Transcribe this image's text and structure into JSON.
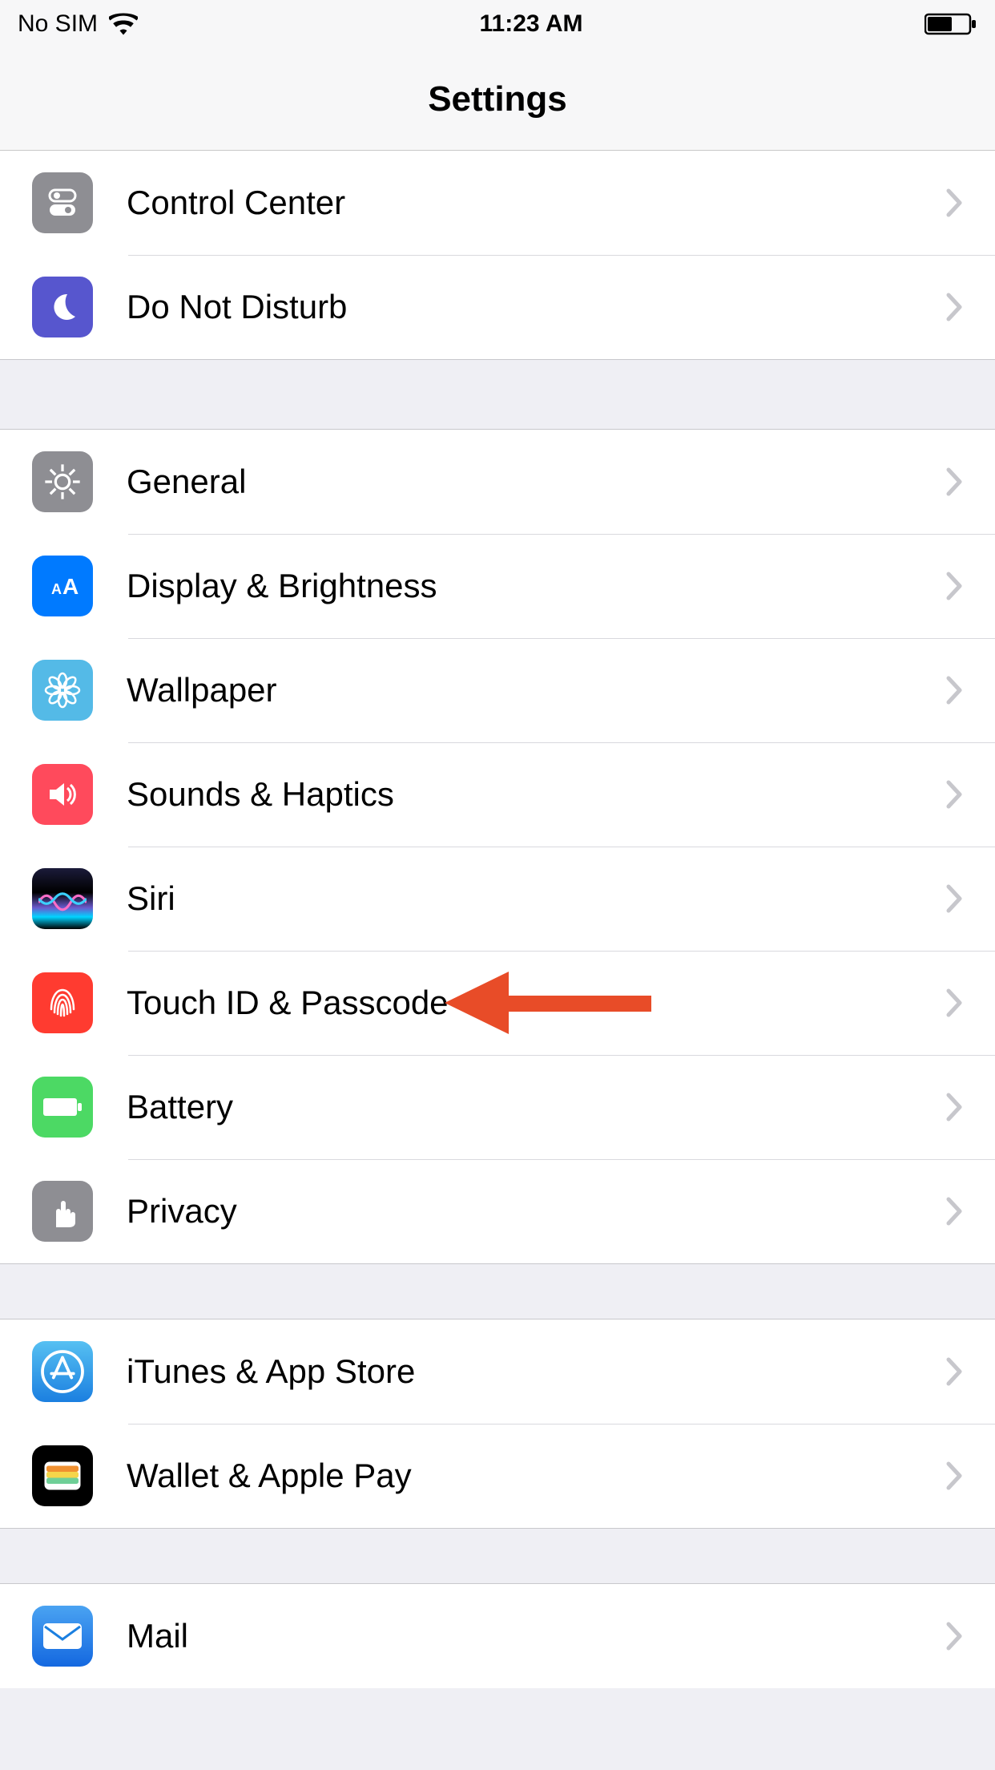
{
  "status_bar": {
    "carrier": "No SIM",
    "time": "11:23 AM"
  },
  "header": {
    "title": "Settings"
  },
  "groups": [
    {
      "items": [
        {
          "id": "control-center",
          "label": "Control Center",
          "icon": "toggles-icon",
          "bg": "bg-grey"
        },
        {
          "id": "do-not-disturb",
          "label": "Do Not Disturb",
          "icon": "moon-icon",
          "bg": "bg-purple"
        }
      ]
    },
    {
      "items": [
        {
          "id": "general",
          "label": "General",
          "icon": "gear-icon",
          "bg": "bg-grey"
        },
        {
          "id": "display-brightness",
          "label": "Display & Brightness",
          "icon": "text-size-icon",
          "bg": "bg-blue"
        },
        {
          "id": "wallpaper",
          "label": "Wallpaper",
          "icon": "flower-icon",
          "bg": "bg-teal"
        },
        {
          "id": "sounds-haptics",
          "label": "Sounds & Haptics",
          "icon": "speaker-icon",
          "bg": "bg-redpink"
        },
        {
          "id": "siri",
          "label": "Siri",
          "icon": "siri-icon",
          "bg": "bg-siri"
        },
        {
          "id": "touch-id-passcode",
          "label": "Touch ID & Passcode",
          "icon": "fingerprint-icon",
          "bg": "bg-red",
          "highlighted": true
        },
        {
          "id": "battery",
          "label": "Battery",
          "icon": "battery-icon",
          "bg": "bg-green"
        },
        {
          "id": "privacy",
          "label": "Privacy",
          "icon": "hand-icon",
          "bg": "bg-grey"
        }
      ]
    },
    {
      "items": [
        {
          "id": "itunes-app-store",
          "label": "iTunes & App Store",
          "icon": "appstore-icon",
          "bg": "bg-appstore"
        },
        {
          "id": "wallet-apple-pay",
          "label": "Wallet & Apple Pay",
          "icon": "wallet-icon",
          "bg": "bg-black"
        }
      ]
    },
    {
      "items": [
        {
          "id": "mail",
          "label": "Mail",
          "icon": "envelope-icon",
          "bg": "bg-mail"
        }
      ]
    }
  ],
  "annotation": {
    "target": "touch-id-passcode",
    "color": "#e84c28"
  }
}
